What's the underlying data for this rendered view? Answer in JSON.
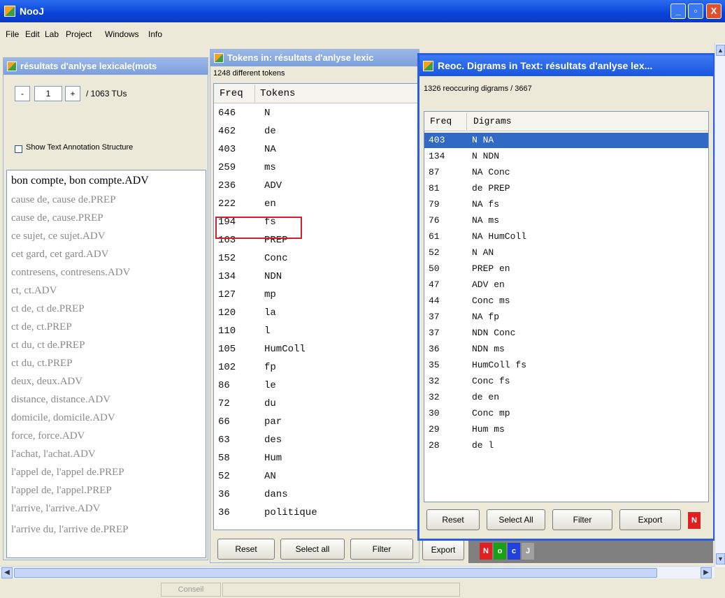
{
  "window": {
    "title": "NooJ",
    "minimize": "_",
    "maximize": "▫",
    "close": "X"
  },
  "menu": [
    "File",
    "Edit",
    "Lab",
    "Project",
    "Windows",
    "Info"
  ],
  "left_panel": {
    "title": "résultats d'anlyse lexicale(mots",
    "pager": {
      "prev": "-",
      "value": "1",
      "next": "+",
      "total": "/ 1063 TUs"
    },
    "checkbox_label": "Show Text Annotation Structure",
    "items": [
      "bon compte, bon compte.ADV",
      "cause de, cause de.PREP",
      "cause de, cause.PREP",
      "ce sujet, ce sujet.ADV",
      "cet gard, cet gard.ADV",
      "contresens, contresens.ADV",
      "ct, ct.ADV",
      "ct de, ct de.PREP",
      "ct de, ct.PREP",
      "ct du, ct de.PREP",
      "ct du, ct.PREP",
      "deux, deux.ADV",
      "distance, distance.ADV",
      "domicile, domicile.ADV",
      "force, force.ADV",
      "l'achat, l'achat.ADV",
      "l'appel de, l'appel de.PREP",
      "l'appel de, l'appel.PREP",
      "l'arrive, l'arrive.ADV",
      "l'arrive du, l'arrive de.PREP"
    ]
  },
  "tokens_panel": {
    "title": "Tokens in: résultats d'anlyse lexic",
    "count": "1248 different tokens",
    "headers": {
      "freq": "Freq",
      "tokens": "Tokens"
    },
    "rows": [
      [
        "646",
        "N"
      ],
      [
        "462",
        "de"
      ],
      [
        "403",
        "NA"
      ],
      [
        "259",
        "ms"
      ],
      [
        "236",
        "ADV"
      ],
      [
        "222",
        "en"
      ],
      [
        "194",
        "fs"
      ],
      [
        "163",
        "PREP"
      ],
      [
        "152",
        "Conc"
      ],
      [
        "134",
        "NDN"
      ],
      [
        "127",
        "mp"
      ],
      [
        "120",
        "la"
      ],
      [
        "110",
        "l"
      ],
      [
        "105",
        "HumColl"
      ],
      [
        "102",
        "fp"
      ],
      [
        "86",
        "le"
      ],
      [
        "72",
        "du"
      ],
      [
        "66",
        "par"
      ],
      [
        "63",
        "des"
      ],
      [
        "58",
        "Hum"
      ],
      [
        "52",
        "AN"
      ],
      [
        "36",
        "dans"
      ],
      [
        "36",
        "politique"
      ]
    ],
    "buttons": {
      "reset": "Reset",
      "select_all": "Select all",
      "filter": "Filter",
      "export": "Export"
    },
    "color_boxes": [
      {
        "label": "N",
        "color": "#e02020"
      },
      {
        "label": "o",
        "color": "#18a018"
      },
      {
        "label": "c",
        "color": "#2040e0"
      },
      {
        "label": "J",
        "color": "#a0a0a0"
      }
    ]
  },
  "digrams_window": {
    "title": "Reoc. Digrams in Text: résultats d'anlyse lex...",
    "count": "1326 reoccuring digrams / 3667",
    "headers": {
      "freq": "Freq",
      "digrams": "Digrams"
    },
    "rows": [
      [
        "403",
        "N NA"
      ],
      [
        "134",
        "N NDN"
      ],
      [
        "87",
        "NA Conc"
      ],
      [
        "81",
        "de PREP"
      ],
      [
        "79",
        "NA fs"
      ],
      [
        "76",
        "NA ms"
      ],
      [
        "61",
        "NA HumColl"
      ],
      [
        "52",
        "N AN"
      ],
      [
        "50",
        "PREP en"
      ],
      [
        "47",
        "ADV en"
      ],
      [
        "44",
        "Conc ms"
      ],
      [
        "37",
        "NA fp"
      ],
      [
        "37",
        "NDN Conc"
      ],
      [
        "36",
        "NDN ms"
      ],
      [
        "35",
        "HumColl fs"
      ],
      [
        "32",
        "Conc fs"
      ],
      [
        "32",
        "de en"
      ],
      [
        "30",
        "Conc mp"
      ],
      [
        "29",
        "Hum ms"
      ],
      [
        "28",
        "de l"
      ]
    ],
    "selected_row": 0,
    "buttons": {
      "reset": "Reset",
      "select_all": "Select All",
      "filter": "Filter",
      "export": "Export",
      "color": "N"
    }
  },
  "status": {
    "cell1": "Conseil"
  },
  "icons": {
    "scroll_up": "▲",
    "scroll_down": "▼",
    "scroll_left": "◀",
    "scroll_right": "▶"
  }
}
